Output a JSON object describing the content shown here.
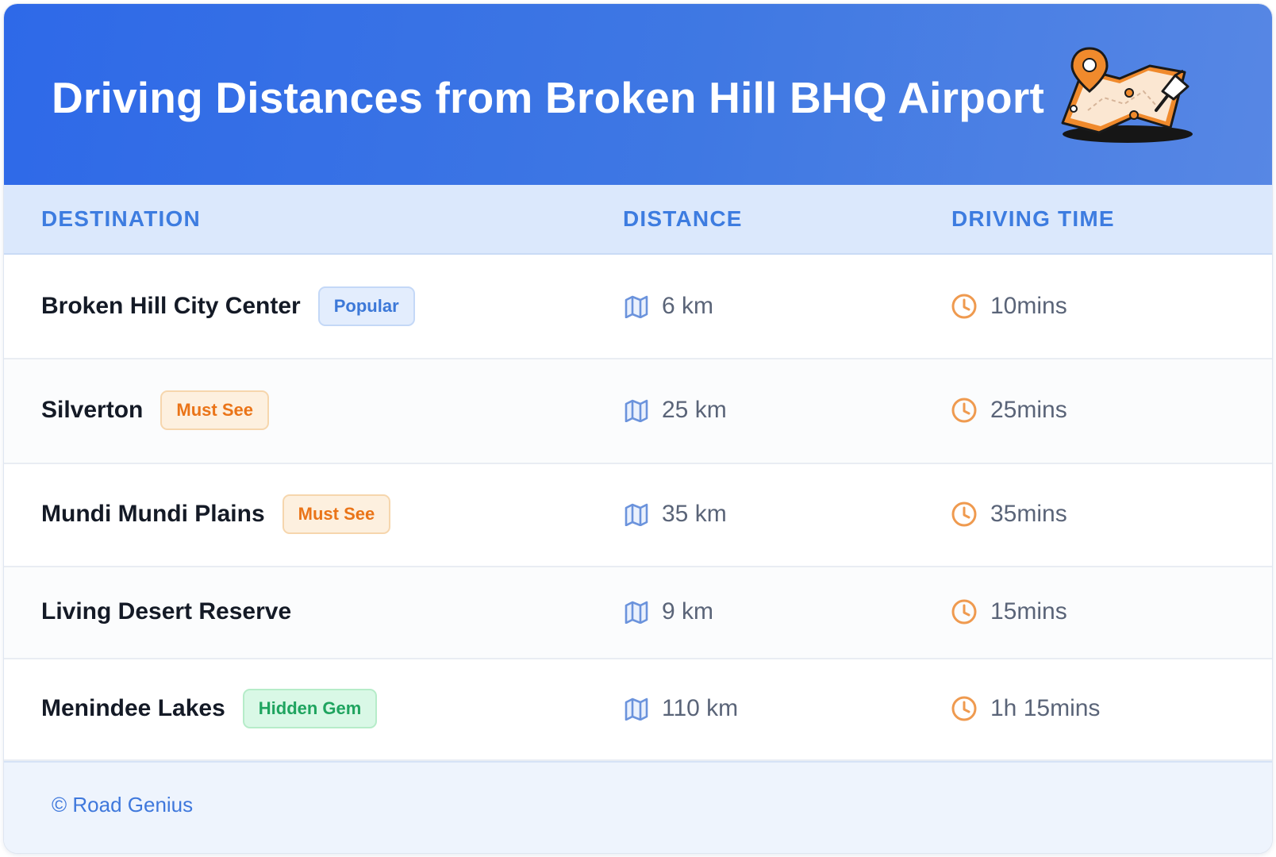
{
  "header": {
    "title": "Driving Distances from Broken Hill BHQ Airport",
    "illustration_icon": "map-with-pins-icon"
  },
  "columns": {
    "destination": "DESTINATION",
    "distance": "DISTANCE",
    "time": "DRIVING TIME"
  },
  "rows": [
    {
      "name": "Broken Hill City Center",
      "badge": "Popular",
      "badge_type": "popular",
      "distance": "6 km",
      "time": "10mins"
    },
    {
      "name": "Silverton",
      "badge": "Must See",
      "badge_type": "mustsee",
      "distance": "25 km",
      "time": "25mins"
    },
    {
      "name": "Mundi Mundi Plains",
      "badge": "Must See",
      "badge_type": "mustsee",
      "distance": "35 km",
      "time": "35mins"
    },
    {
      "name": "Living Desert Reserve",
      "badge": "",
      "badge_type": "",
      "distance": "9 km",
      "time": "15mins"
    },
    {
      "name": "Menindee Lakes",
      "badge": "Hidden Gem",
      "badge_type": "gem",
      "distance": "110 km",
      "time": "1h 15mins"
    }
  ],
  "icons": {
    "distance": "map-icon",
    "time": "clock-icon"
  },
  "colors": {
    "header_blue": "#2e69e8",
    "accent_blue": "#3d7ce0",
    "popular_badge": "#3c78d8",
    "must_see_badge": "#ea7418",
    "hidden_gem_badge": "#1fa45f",
    "map_icon": "#6b93dc",
    "clock_icon": "#ef9a4f"
  },
  "footer": {
    "text": "© Road Genius"
  }
}
